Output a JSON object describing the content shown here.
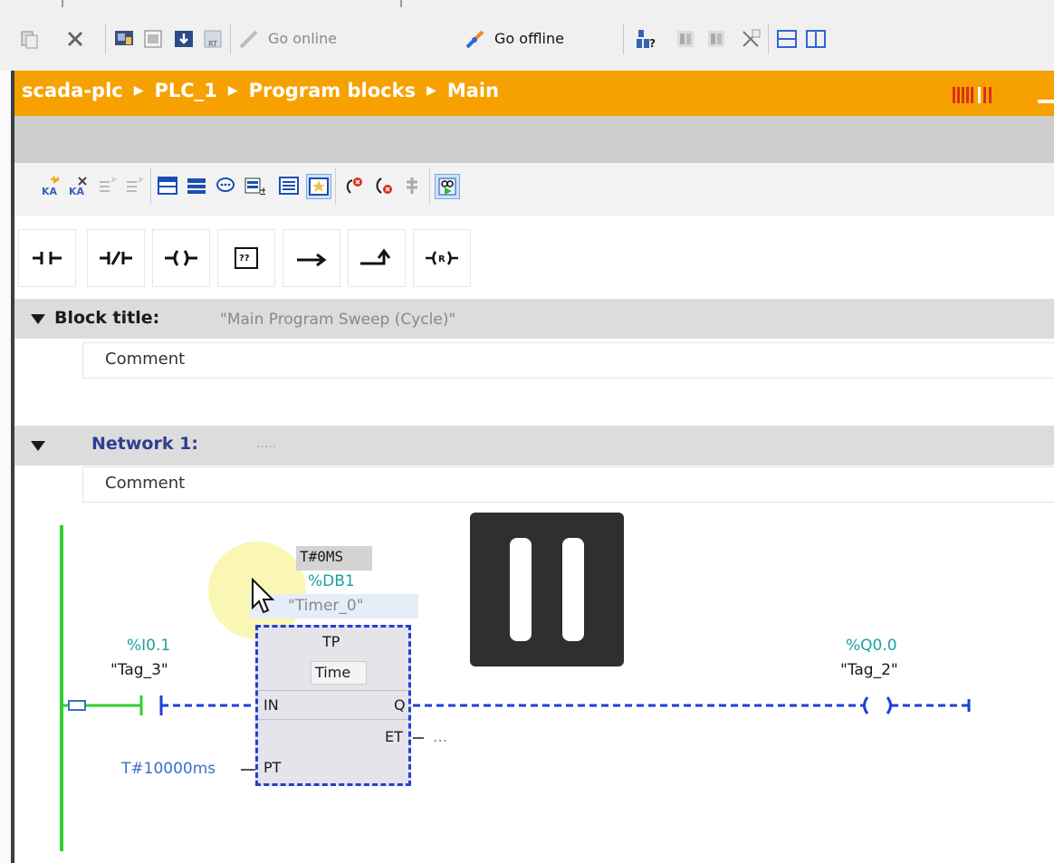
{
  "toolbar": {
    "go_online_label": "Go online",
    "go_offline_label": "Go offline"
  },
  "breadcrumb": {
    "project": "scada-plc",
    "device": "PLC_1",
    "folder": "Program blocks",
    "block": "Main"
  },
  "instructions": {
    "no_contact": "⊣⊢",
    "nc_contact": "⊣/⊢",
    "coil": "–( )–",
    "empty_box": "??",
    "open_branch": "↦",
    "close_branch": "↥",
    "reset_coil": "–(R)–"
  },
  "block": {
    "title_label": "Block title:",
    "title_value": "\"Main Program Sweep (Cycle)\"",
    "comment": "Comment"
  },
  "network": {
    "label": "Network 1:",
    "title_placeholder": ".....",
    "comment": "Comment",
    "contact": {
      "address": "%I0.1",
      "tag": "\"Tag_3\""
    },
    "timer": {
      "monitor_value": "T#0MS",
      "db_address": "%DB1",
      "db_name": "\"Timer_0\"",
      "type": "TP",
      "data_type": "Time",
      "pin_in": "IN",
      "pin_q": "Q",
      "pin_et": "ET",
      "pin_pt": "PT",
      "pt_value": "T#10000ms",
      "et_value": "..."
    },
    "coil": {
      "address": "%Q0.0",
      "tag": "\"Tag_2\""
    }
  },
  "colors": {
    "breadcrumb_bg": "#f7a100",
    "power_rail": "#2fd12f",
    "wire_blue": "#1f3fd6",
    "address_teal": "#1aa0a0"
  },
  "overlay": {
    "state": "paused"
  }
}
